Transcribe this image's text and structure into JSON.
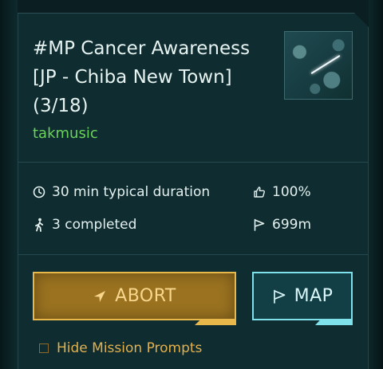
{
  "mission": {
    "title": "#MP Cancer Awareness\n[JP - Chiba New Town]\n(3/18)",
    "author": "takmusic",
    "thumbnail_icon": "mission-thumbnail-image"
  },
  "stats": {
    "duration": "30 min typical duration",
    "rating": "100%",
    "completed": "3 completed",
    "distance": "699m"
  },
  "actions": {
    "abort_label": "ABORT",
    "map_label": "MAP"
  },
  "options": {
    "hide_prompts_label": "Hide Mission Prompts",
    "hide_prompts_checked": false
  },
  "colors": {
    "author": "#6ad35a",
    "abort": "#e8b84a",
    "map": "#7fe2ea"
  }
}
